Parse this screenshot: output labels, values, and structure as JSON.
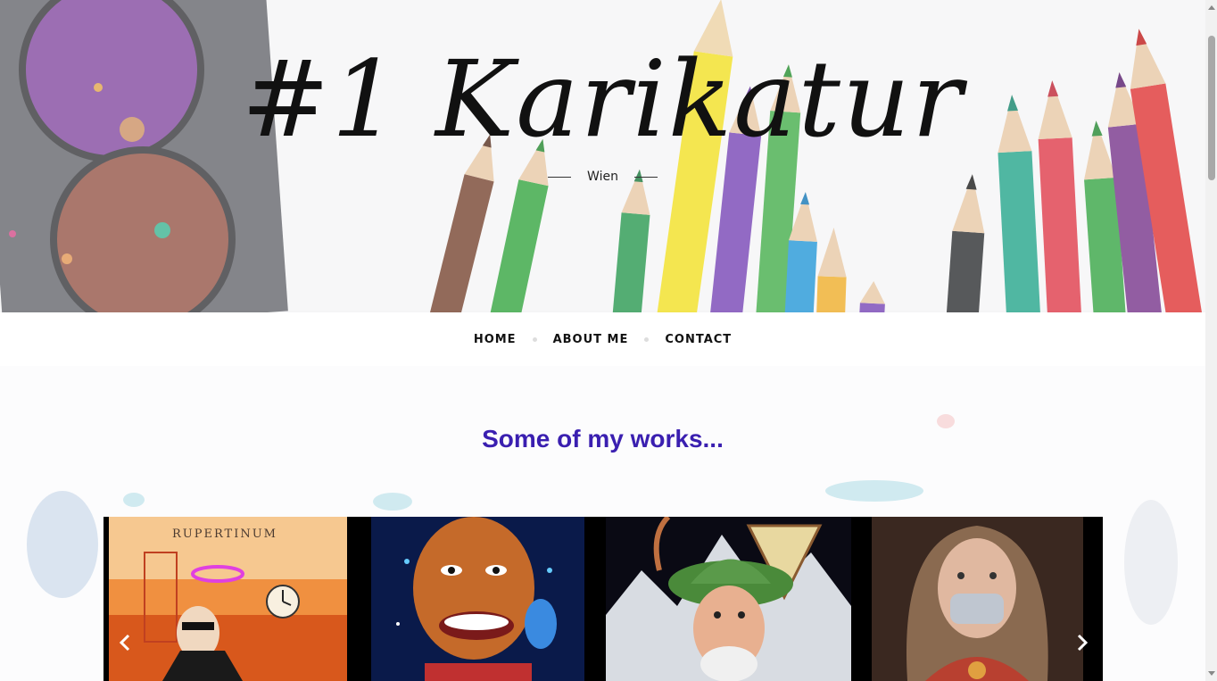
{
  "header": {
    "site_title": "#1 Karikatur",
    "tagline": "Wien"
  },
  "nav": {
    "items": [
      {
        "label": "HOME"
      },
      {
        "label": "ABOUT ME"
      },
      {
        "label": "CONTACT"
      }
    ]
  },
  "main": {
    "section_title": "Some of my works...",
    "carousel": {
      "slides": [
        {
          "name": "caricature-rupertinum",
          "caption": "RUPERTINUM"
        },
        {
          "name": "caricature-smiling-man"
        },
        {
          "name": "caricature-alpine-man"
        },
        {
          "name": "caricature-madonna-mask"
        }
      ],
      "prev_icon": "chevron-left-icon",
      "next_icon": "chevron-right-icon"
    }
  },
  "colors": {
    "accent": "#3a1fb0",
    "nav_text": "#111111",
    "title_text": "#111111"
  }
}
